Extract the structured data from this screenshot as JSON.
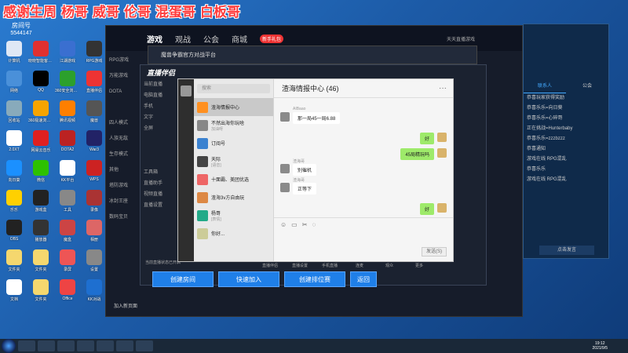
{
  "banner": [
    "感谢生周",
    "杨哥",
    "威哥",
    "伦哥",
    "混蛋哥",
    "白板哥"
  ],
  "room": {
    "label": "房间号",
    "number": "5544147"
  },
  "desktop_icons": [
    {
      "label": "计算机",
      "color": "#dfe8f5"
    },
    {
      "label": "晓晓智能客户端",
      "color": "#e03030"
    },
    {
      "label": "江湖游戏",
      "color": "#3a6fd0"
    },
    {
      "label": "RPG游戏",
      "color": "#333"
    },
    {
      "label": "网络",
      "color": "#4a90d9"
    },
    {
      "label": "QQ",
      "color": "#000"
    },
    {
      "label": "360安全浏览器",
      "color": "#2ca02c"
    },
    {
      "label": "直播伴侣",
      "color": "#e33"
    },
    {
      "label": "回收站",
      "color": "#8ab"
    },
    {
      "label": "360极速浏览器",
      "color": "#f7a400"
    },
    {
      "label": "腾讯视频",
      "color": "#ff7f00"
    },
    {
      "label": "魔兽",
      "color": "#555"
    },
    {
      "label": "2.0XT",
      "color": "#fff"
    },
    {
      "label": "网易云音乐",
      "color": "#e02020"
    },
    {
      "label": "DOTA2",
      "color": "#b22"
    },
    {
      "label": "War3",
      "color": "#226"
    },
    {
      "label": "向日葵",
      "color": "#1b90ff"
    },
    {
      "label": "微信",
      "color": "#2dc100"
    },
    {
      "label": "KK平台",
      "color": "#fff"
    },
    {
      "label": "WPS",
      "color": "#c22"
    },
    {
      "label": "乐乐",
      "color": "#ffd000"
    },
    {
      "label": "游戏盒",
      "color": "#222"
    },
    {
      "label": "工具",
      "color": "#888"
    },
    {
      "label": "录像",
      "color": "#a33"
    },
    {
      "label": "OBS",
      "color": "#222"
    },
    {
      "label": "播放器",
      "color": "#333"
    },
    {
      "label": "魔盒",
      "color": "#c44"
    },
    {
      "label": "相册",
      "color": "#d66"
    },
    {
      "label": "文件夹",
      "color": "#f5d76e"
    },
    {
      "label": "文件夹",
      "color": "#f5d76e"
    },
    {
      "label": "录屏",
      "color": "#e55"
    },
    {
      "label": "设置",
      "color": "#888"
    },
    {
      "label": "文档",
      "color": "#fff"
    },
    {
      "label": "文件夹",
      "color": "#f5d76e"
    },
    {
      "label": "Office",
      "color": "#e44"
    },
    {
      "label": "KK对战",
      "color": "#1e6fd0"
    }
  ],
  "game": {
    "tabs": [
      "游戏",
      "观战",
      "公会",
      "商城"
    ],
    "active_tab": "游戏",
    "badge": "新手礼包",
    "user": "天天直播游戏",
    "side_items": [
      "RPG游戏",
      "万能游戏",
      "DOTA",
      "",
      "四人模式",
      "人族无敌",
      "生存模式",
      "其他",
      "塔防游戏",
      "冰封王座",
      "数码宝贝"
    ],
    "lobby": "加入新页面",
    "buttons": {
      "create_room": "创建房间",
      "quick_join": "快速加入",
      "create_rank": "创建排位赛",
      "back": "返回"
    }
  },
  "platform_bar": {
    "title": "魔兽争霸官方对战平台"
  },
  "right_panel": {
    "tabs": [
      "联系人",
      "公会"
    ],
    "messages": [
      {
        "name": "",
        "text": "恭喜玩家获得奖励"
      },
      {
        "name": "",
        "text": "恭喜乐乐=向日葵"
      },
      {
        "name": "",
        "text": "恭喜乐乐=心碎哥"
      },
      {
        "name": "",
        "text": "正在挑战=Hunterbaby"
      },
      {
        "name": "",
        "text": "恭喜乐乐=zzzbzzz"
      },
      {
        "name": "",
        "text": "恭喜通知"
      },
      {
        "name": "",
        "text": "游戏在线 RPG混乱"
      },
      {
        "name": "",
        "text": "恭喜乐乐"
      },
      {
        "name": "",
        "text": "游戏在线 RPG混乱"
      }
    ],
    "footer": "点击发言"
  },
  "zb": {
    "title": "直播伴侣",
    "left_items": [
      "当前直播",
      "电脑直播",
      "手机",
      "文字",
      "全屏",
      "",
      "",
      "",
      "工具箱",
      "直播助手",
      "视频直播",
      "直播设置"
    ],
    "bottom_text": "当前直播状态已开启",
    "tools": [
      "直播伴侣",
      "直播设置",
      "手机直播",
      "连麦",
      "观众",
      "更多"
    ]
  },
  "chat": {
    "search_placeholder": "搜索",
    "list": [
      {
        "name": "渣海情报中心",
        "sub": "",
        "time": "",
        "color": "#ff9020"
      },
      {
        "name": "不然出海你玩啥",
        "sub": "加油呀",
        "time": "",
        "color": "#888"
      },
      {
        "name": "订阅号",
        "sub": "",
        "time": "",
        "color": "#3b82d0"
      },
      {
        "name": "天际",
        "sub": "[语音]",
        "time": "",
        "color": "#444"
      },
      {
        "name": "十面霸、美团优选",
        "sub": "",
        "time": "",
        "color": "#e66"
      },
      {
        "name": "渣海3v方自由玩",
        "sub": "",
        "time": "",
        "color": "#d84"
      },
      {
        "name": "杨哥",
        "sub": "[表情]",
        "time": "",
        "color": "#2a8"
      },
      {
        "name": "你好...",
        "sub": "",
        "time": "",
        "color": "#cc9"
      }
    ],
    "title": "渣海情报中心 (46)",
    "messages": [
      {
        "who": "AIBaao",
        "text": "那一局45一局6.88",
        "me": false
      },
      {
        "who": "",
        "text": "好",
        "me": true
      },
      {
        "who": "",
        "text": "45局精玩吗",
        "me": true
      },
      {
        "who": "渣海哥",
        "text": "别催机",
        "me": false
      },
      {
        "who": "渣海哥",
        "text": "正等下",
        "me": false
      },
      {
        "who": "",
        "text": "好",
        "me": true
      }
    ],
    "send_label": "发送(S)"
  },
  "taskbar": {
    "time": "19:12",
    "date": "2021/9/5"
  }
}
